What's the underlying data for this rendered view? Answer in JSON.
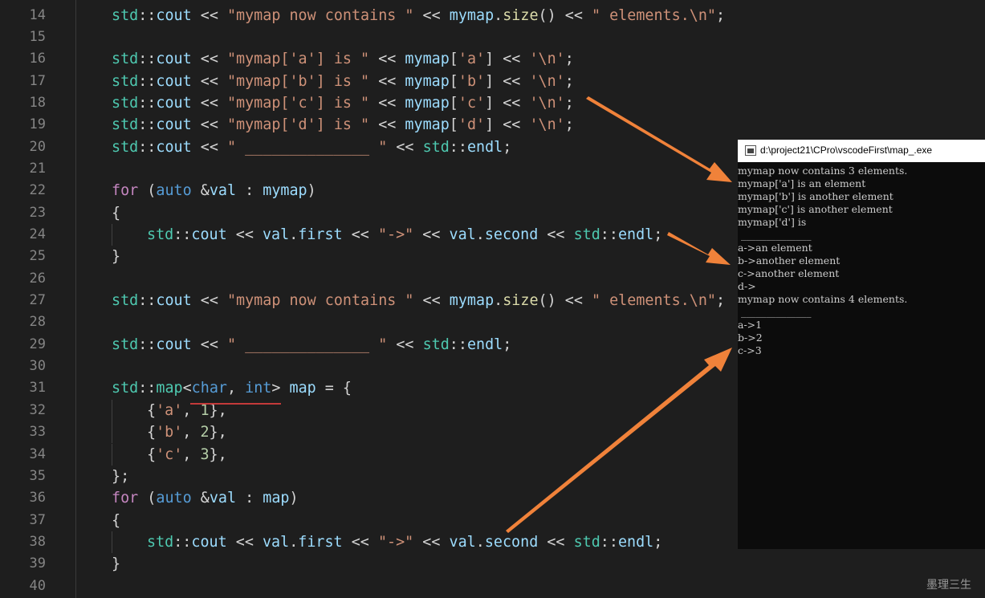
{
  "editor": {
    "lines": [
      {
        "num": "14",
        "indent": 1,
        "tokens": [
          [
            "ns",
            "std"
          ],
          [
            "op",
            "::"
          ],
          [
            "var",
            "cout"
          ],
          [
            "op",
            " << "
          ],
          [
            "str",
            "\"mymap now contains \""
          ],
          [
            "op",
            " << "
          ],
          [
            "var",
            "mymap"
          ],
          [
            "op",
            "."
          ],
          [
            "fn",
            "size"
          ],
          [
            "op",
            "() << "
          ],
          [
            "str",
            "\" elements.\\n\""
          ],
          [
            "op",
            ";"
          ]
        ]
      },
      {
        "num": "15",
        "indent": 0,
        "tokens": []
      },
      {
        "num": "16",
        "indent": 1,
        "tokens": [
          [
            "ns",
            "std"
          ],
          [
            "op",
            "::"
          ],
          [
            "var",
            "cout"
          ],
          [
            "op",
            " << "
          ],
          [
            "str",
            "\"mymap['a'] is \""
          ],
          [
            "op",
            " << "
          ],
          [
            "var",
            "mymap"
          ],
          [
            "op",
            "["
          ],
          [
            "str",
            "'a'"
          ],
          [
            "op",
            "] << "
          ],
          [
            "str",
            "'\\n'"
          ],
          [
            "op",
            ";"
          ]
        ]
      },
      {
        "num": "17",
        "indent": 1,
        "tokens": [
          [
            "ns",
            "std"
          ],
          [
            "op",
            "::"
          ],
          [
            "var",
            "cout"
          ],
          [
            "op",
            " << "
          ],
          [
            "str",
            "\"mymap['b'] is \""
          ],
          [
            "op",
            " << "
          ],
          [
            "var",
            "mymap"
          ],
          [
            "op",
            "["
          ],
          [
            "str",
            "'b'"
          ],
          [
            "op",
            "] << "
          ],
          [
            "str",
            "'\\n'"
          ],
          [
            "op",
            ";"
          ]
        ]
      },
      {
        "num": "18",
        "indent": 1,
        "tokens": [
          [
            "ns",
            "std"
          ],
          [
            "op",
            "::"
          ],
          [
            "var",
            "cout"
          ],
          [
            "op",
            " << "
          ],
          [
            "str",
            "\"mymap['c'] is \""
          ],
          [
            "op",
            " << "
          ],
          [
            "var",
            "mymap"
          ],
          [
            "op",
            "["
          ],
          [
            "str",
            "'c'"
          ],
          [
            "op",
            "] << "
          ],
          [
            "str",
            "'\\n'"
          ],
          [
            "op",
            ";"
          ]
        ]
      },
      {
        "num": "19",
        "indent": 1,
        "tokens": [
          [
            "ns",
            "std"
          ],
          [
            "op",
            "::"
          ],
          [
            "var",
            "cout"
          ],
          [
            "op",
            " << "
          ],
          [
            "str",
            "\"mymap['d'] is \""
          ],
          [
            "op",
            " << "
          ],
          [
            "var",
            "mymap"
          ],
          [
            "op",
            "["
          ],
          [
            "str",
            "'d'"
          ],
          [
            "op",
            "] << "
          ],
          [
            "str",
            "'\\n'"
          ],
          [
            "op",
            ";"
          ]
        ]
      },
      {
        "num": "20",
        "indent": 1,
        "tokens": [
          [
            "ns",
            "std"
          ],
          [
            "op",
            "::"
          ],
          [
            "var",
            "cout"
          ],
          [
            "op",
            " << "
          ],
          [
            "str",
            "\" ______________ \""
          ],
          [
            "op",
            " << "
          ],
          [
            "ns",
            "std"
          ],
          [
            "op",
            "::"
          ],
          [
            "var",
            "endl"
          ],
          [
            "op",
            ";"
          ]
        ]
      },
      {
        "num": "21",
        "indent": 0,
        "tokens": []
      },
      {
        "num": "22",
        "indent": 1,
        "tokens": [
          [
            "kw",
            "for"
          ],
          [
            "op",
            " ("
          ],
          [
            "type",
            "auto"
          ],
          [
            "op",
            " &"
          ],
          [
            "var",
            "val"
          ],
          [
            "op",
            " : "
          ],
          [
            "var",
            "mymap"
          ],
          [
            "op",
            ")"
          ]
        ]
      },
      {
        "num": "23",
        "indent": 1,
        "tokens": [
          [
            "op",
            "{"
          ]
        ]
      },
      {
        "num": "24",
        "indent": 2,
        "guide": true,
        "tokens": [
          [
            "ns",
            "std"
          ],
          [
            "op",
            "::"
          ],
          [
            "var",
            "cout"
          ],
          [
            "op",
            " << "
          ],
          [
            "var",
            "val"
          ],
          [
            "op",
            "."
          ],
          [
            "var",
            "first"
          ],
          [
            "op",
            " << "
          ],
          [
            "str",
            "\"->\""
          ],
          [
            "op",
            " << "
          ],
          [
            "var",
            "val"
          ],
          [
            "op",
            "."
          ],
          [
            "var",
            "second"
          ],
          [
            "op",
            " << "
          ],
          [
            "ns",
            "std"
          ],
          [
            "op",
            "::"
          ],
          [
            "var",
            "endl"
          ],
          [
            "op",
            ";"
          ]
        ]
      },
      {
        "num": "25",
        "indent": 1,
        "tokens": [
          [
            "op",
            "}"
          ]
        ]
      },
      {
        "num": "26",
        "indent": 0,
        "tokens": []
      },
      {
        "num": "27",
        "indent": 1,
        "tokens": [
          [
            "ns",
            "std"
          ],
          [
            "op",
            "::"
          ],
          [
            "var",
            "cout"
          ],
          [
            "op",
            " << "
          ],
          [
            "str",
            "\"mymap now contains \""
          ],
          [
            "op",
            " << "
          ],
          [
            "var",
            "mymap"
          ],
          [
            "op",
            "."
          ],
          [
            "fn",
            "size"
          ],
          [
            "op",
            "() << "
          ],
          [
            "str",
            "\" elements.\\n\""
          ],
          [
            "op",
            ";"
          ]
        ]
      },
      {
        "num": "28",
        "indent": 0,
        "tokens": []
      },
      {
        "num": "29",
        "indent": 1,
        "tokens": [
          [
            "ns",
            "std"
          ],
          [
            "op",
            "::"
          ],
          [
            "var",
            "cout"
          ],
          [
            "op",
            " << "
          ],
          [
            "str",
            "\" ______________ \""
          ],
          [
            "op",
            " << "
          ],
          [
            "ns",
            "std"
          ],
          [
            "op",
            "::"
          ],
          [
            "var",
            "endl"
          ],
          [
            "op",
            ";"
          ]
        ]
      },
      {
        "num": "30",
        "indent": 0,
        "tokens": []
      },
      {
        "num": "31",
        "indent": 1,
        "tokens": [
          [
            "ns",
            "std"
          ],
          [
            "op",
            "::"
          ],
          [
            "ns",
            "map"
          ],
          [
            "op",
            "<"
          ],
          [
            "type",
            "char"
          ],
          [
            "op",
            ", "
          ],
          [
            "type",
            "int"
          ],
          [
            "op",
            "> "
          ],
          [
            "var",
            "map"
          ],
          [
            "op",
            " = {"
          ]
        ]
      },
      {
        "num": "32",
        "indent": 2,
        "guide": true,
        "tokens": [
          [
            "op",
            "{"
          ],
          [
            "str",
            "'a'"
          ],
          [
            "op",
            ", "
          ],
          [
            "num",
            "1"
          ],
          [
            "op",
            "},"
          ]
        ]
      },
      {
        "num": "33",
        "indent": 2,
        "guide": true,
        "tokens": [
          [
            "op",
            "{"
          ],
          [
            "str",
            "'b'"
          ],
          [
            "op",
            ", "
          ],
          [
            "num",
            "2"
          ],
          [
            "op",
            "},"
          ]
        ]
      },
      {
        "num": "34",
        "indent": 2,
        "guide": true,
        "tokens": [
          [
            "op",
            "{"
          ],
          [
            "str",
            "'c'"
          ],
          [
            "op",
            ", "
          ],
          [
            "num",
            "3"
          ],
          [
            "op",
            "},"
          ]
        ]
      },
      {
        "num": "35",
        "indent": 1,
        "tokens": [
          [
            "op",
            "};"
          ]
        ]
      },
      {
        "num": "36",
        "indent": 1,
        "tokens": [
          [
            "kw",
            "for"
          ],
          [
            "op",
            " ("
          ],
          [
            "type",
            "auto"
          ],
          [
            "op",
            " &"
          ],
          [
            "var",
            "val"
          ],
          [
            "op",
            " : "
          ],
          [
            "var",
            "map"
          ],
          [
            "op",
            ")"
          ]
        ]
      },
      {
        "num": "37",
        "indent": 1,
        "tokens": [
          [
            "op",
            "{"
          ]
        ]
      },
      {
        "num": "38",
        "indent": 2,
        "guide": true,
        "tokens": [
          [
            "ns",
            "std"
          ],
          [
            "op",
            "::"
          ],
          [
            "var",
            "cout"
          ],
          [
            "op",
            " << "
          ],
          [
            "var",
            "val"
          ],
          [
            "op",
            "."
          ],
          [
            "var",
            "first"
          ],
          [
            "op",
            " << "
          ],
          [
            "str",
            "\"->\""
          ],
          [
            "op",
            " << "
          ],
          [
            "var",
            "val"
          ],
          [
            "op",
            "."
          ],
          [
            "var",
            "second"
          ],
          [
            "op",
            " << "
          ],
          [
            "ns",
            "std"
          ],
          [
            "op",
            "::"
          ],
          [
            "var",
            "endl"
          ],
          [
            "op",
            ";"
          ]
        ]
      },
      {
        "num": "39",
        "indent": 1,
        "tokens": [
          [
            "op",
            "}"
          ]
        ]
      },
      {
        "num": "40",
        "indent": 0,
        "tokens": []
      }
    ]
  },
  "console": {
    "title": "d:\\project21\\CPro\\vscodeFirst\\map_.exe",
    "output": [
      "mymap now contains 3 elements.",
      "mymap['a'] is an element",
      "mymap['b'] is another element",
      "mymap['c'] is another element",
      "mymap['d'] is",
      " ______________",
      "a->an element",
      "b->another element",
      "c->another element",
      "d->",
      "mymap now contains 4 elements.",
      " ______________",
      "a->1",
      "b->2",
      "c->3"
    ]
  },
  "watermark": "墨理三生",
  "colors": {
    "editor_bg": "#1e1e1e",
    "console_bg": "#0c0c0c",
    "arrow": "#f0823a",
    "squiggle": "#c43a3a"
  }
}
